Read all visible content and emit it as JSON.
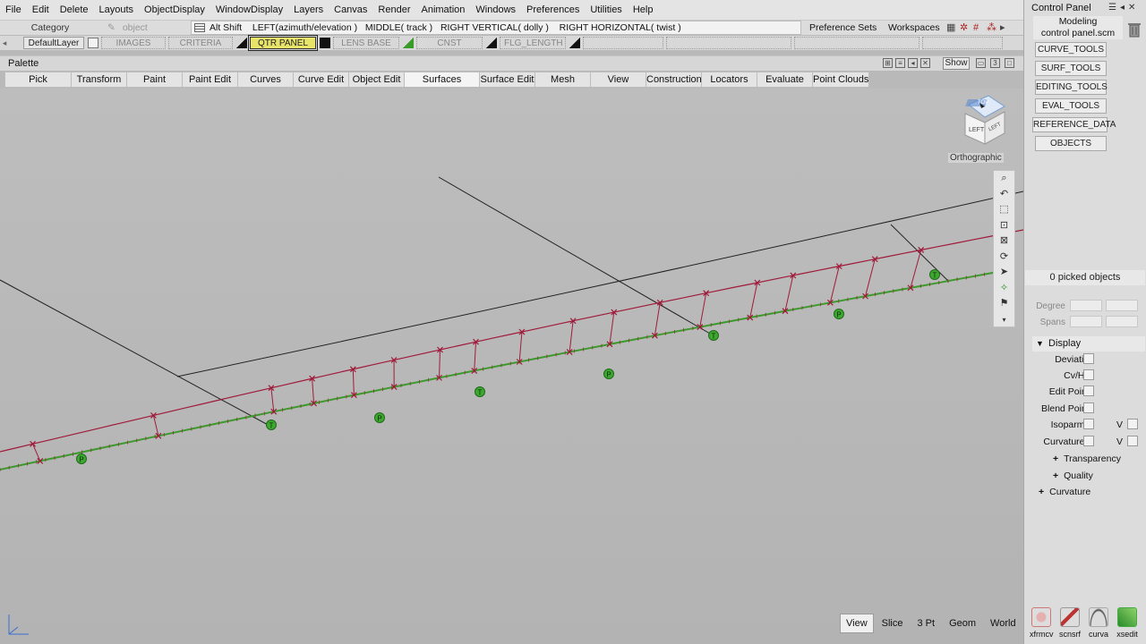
{
  "menubar": {
    "items": [
      "File",
      "Edit",
      "Delete",
      "Layouts",
      "ObjectDisplay",
      "WindowDisplay",
      "Layers",
      "Canvas",
      "Render",
      "Animation",
      "Windows",
      "Preferences",
      "Utilities",
      "Help"
    ]
  },
  "row2": {
    "category_label": "Category",
    "object_label": "object",
    "hint_modifier": "Alt Shift",
    "hint_left": "LEFT(azimuth/elevation )",
    "hint_middle": "MIDDLE( track )",
    "hint_right_vertical": "RIGHT VERTICAL( dolly )",
    "hint_right_horizontal": "RIGHT HORIZONTAL( twist )",
    "preference_sets": "Preference Sets",
    "workspaces": "Workspaces"
  },
  "layers": {
    "default": "DefaultLayer",
    "items": [
      "IMAGES",
      "CRITERIA",
      "QTR PANEL",
      "LENS BASE",
      "CNST",
      "FLG_LENGTH"
    ]
  },
  "palette": {
    "title": "Palette",
    "show_label": "Show",
    "tabs": [
      "Pick",
      "Transform",
      "Paint",
      "Paint Edit",
      "Curves",
      "Curve Edit",
      "Object Edit",
      "Surfaces",
      "Surface Edit",
      "Mesh",
      "View",
      "Construction",
      "Locators",
      "Evaluate",
      "Point Clouds"
    ],
    "active_tab": "Surfaces"
  },
  "viewport": {
    "projection_label": "Orthographic",
    "cube_faces": {
      "left": "LEFT",
      "right": "LEFT",
      "top": "TOP"
    },
    "view_buttons": [
      "View",
      "Slice",
      "3 Pt",
      "Geom",
      "World"
    ],
    "active_view_button": "View",
    "curve_colors": {
      "red": "#a01a3a",
      "green": "#3b9a2b",
      "marker": "#3da82f",
      "line": "#222222"
    }
  },
  "control_panel": {
    "title": "Control Panel",
    "mode": "Modeling",
    "file": "control panel.scm",
    "tool_buttons": [
      "CURVE_TOOLS",
      "SURF_TOOLS",
      "EDITING_TOOLS",
      "EVAL_TOOLS",
      "REFERENCE_DATA",
      "OBJECTS"
    ],
    "picked_objects": "0 picked objects",
    "degree_label": "Degree",
    "spans_label": "Spans",
    "display": {
      "header": "Display",
      "rows": [
        {
          "label": "Deviation"
        },
        {
          "label": "Cv/Hull"
        },
        {
          "label": "Edit Points"
        },
        {
          "label": "Blend Points"
        },
        {
          "label": "Isoparm U",
          "v_label": "V"
        },
        {
          "label": "Curvature U",
          "v_label": "V"
        }
      ],
      "sub_sections": [
        "Transparency",
        "Quality"
      ]
    },
    "curvature_section": "Curvature",
    "shelf": [
      "xfrmcv",
      "scnsrf",
      "curva",
      "xsedit"
    ]
  }
}
